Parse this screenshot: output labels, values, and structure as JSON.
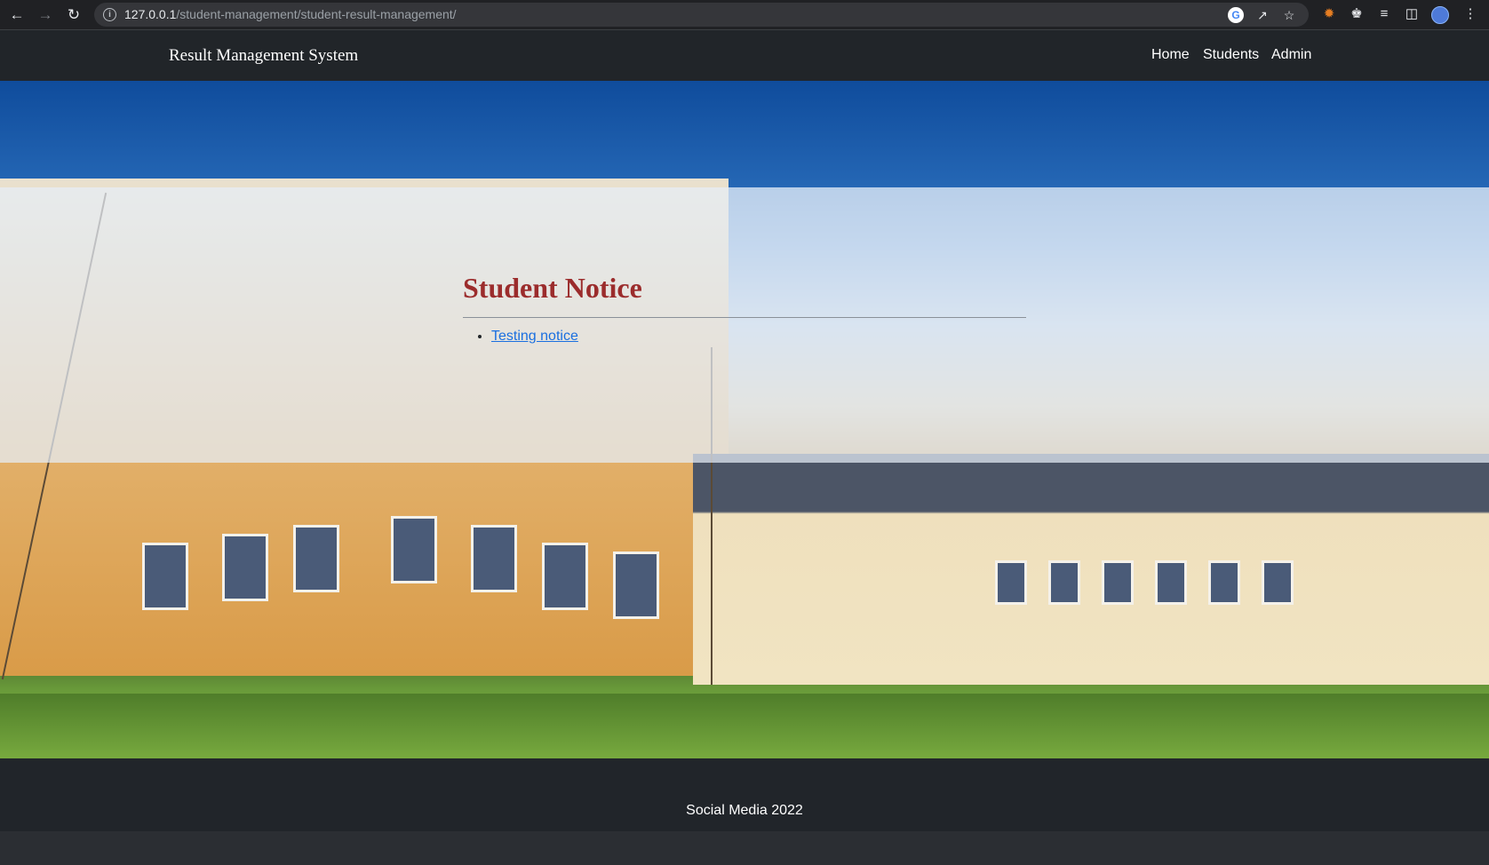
{
  "browser": {
    "url_host": "127.0.0.1",
    "url_path": "/student-management/student-result-management/"
  },
  "navbar": {
    "brand": "Result Management System",
    "links": [
      "Home",
      "Students",
      "Admin"
    ]
  },
  "notice": {
    "title": "Student Notice",
    "items": [
      "Testing notice"
    ]
  },
  "footer": {
    "text": "Social Media 2022"
  }
}
